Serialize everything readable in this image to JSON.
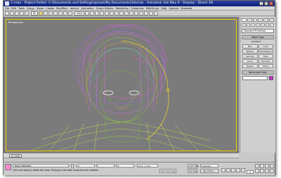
{
  "window": {
    "title": "C.max - Project Folder: C:\\Documents and Settings\\sprook\\My Documents\\3dsmax - Autodesk 3ds Max 9 - Display : Direct 3D"
  },
  "menu": [
    "File",
    "Edit",
    "Tools",
    "Group",
    "Views",
    "Create",
    "Modifiers",
    "reactor",
    "Animation",
    "Graph Editors",
    "Rendering",
    "Customize",
    "MAXScript",
    "Help",
    "Sprocks",
    "Illustrate"
  ],
  "toolbar": {
    "selection_filter": "All",
    "coord_system": "View"
  },
  "viewport": {
    "label": "Perspective"
  },
  "command_panel": {
    "category_dropdown": "Standard Primitives",
    "rollout_object_type": "Object Type",
    "autogrid_label": "AutoGrid",
    "buttons": [
      "Box",
      "Cone",
      "Sphere",
      "GeoSphere",
      "Cylinder",
      "Tube",
      "Torus",
      "Pyramid",
      "Teapot",
      "Plane"
    ],
    "rollout_name_color": "Name and Color",
    "accent_color": "#d22fd2"
  },
  "timeline": {
    "slider_label": "0 / 100"
  },
  "status": {
    "selection": "None Selected",
    "prompt": "Click and drag to rotate the view. Clicking in the tabs constrains the rotation",
    "x_label": "X",
    "y_label": "Y",
    "z_label": "Z",
    "grid": "Grid = 10.0",
    "auto_key": "Auto Key",
    "set_key": "Set Key",
    "key_filter": "Selected",
    "key_filters_btn": "Key Filters...",
    "add_time_tag": "Add Time Tag",
    "frame": "0"
  },
  "colors": {
    "titlebar": "#0a1f7a",
    "viewport_bg": "#7b7b7b",
    "active_border": "#f0d000"
  }
}
